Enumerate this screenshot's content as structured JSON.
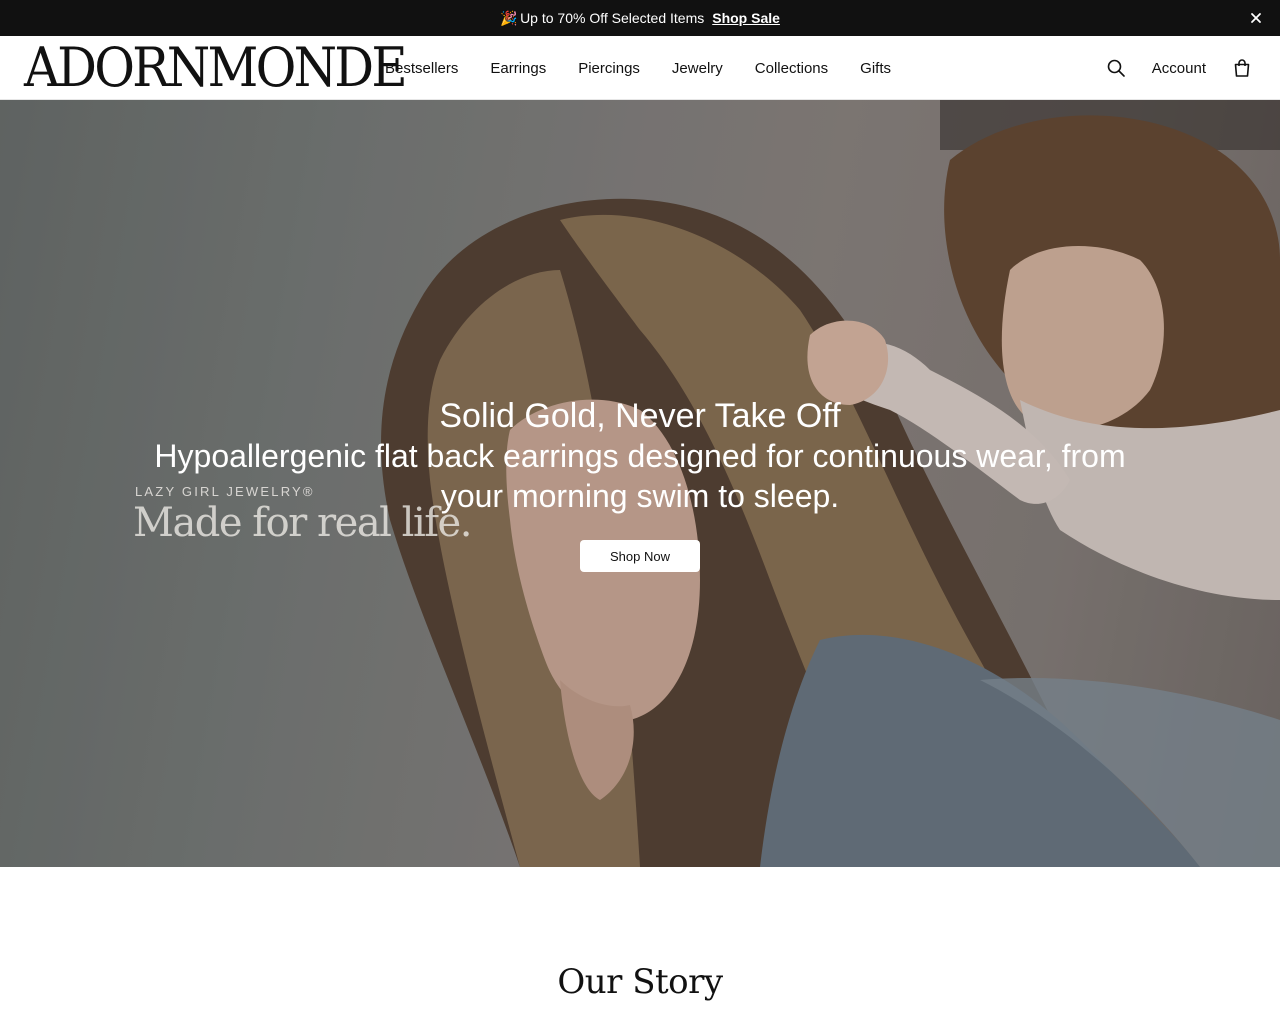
{
  "announcement": {
    "message": "Up to 70% Off Selected Items",
    "link_label": "Shop Sale",
    "party_icon": "party-popper-icon",
    "close_icon": "close-icon"
  },
  "header": {
    "logo_text": "ADORNMONDE",
    "nav": [
      {
        "label": "Bestsellers"
      },
      {
        "label": "Earrings"
      },
      {
        "label": "Piercings"
      },
      {
        "label": "Jewelry"
      },
      {
        "label": "Collections"
      },
      {
        "label": "Gifts"
      }
    ],
    "account_label": "Account",
    "search_icon": "search-icon",
    "bag_icon": "shopping-bag-icon"
  },
  "hero": {
    "brand_small": "LAZY GIRL JEWELRY®",
    "brand_large": "Made for real life.",
    "title": "Solid Gold, Never Take Off",
    "subtitle": "Hypoallergenic flat back earrings designed for continuous wear, from your morning swim to sleep.",
    "cta_label": "Shop Now"
  },
  "story": {
    "title": "Our Story"
  },
  "colors": {
    "announcement_bg": "#111111",
    "text": "#111111",
    "button_bg": "#ffffff"
  }
}
